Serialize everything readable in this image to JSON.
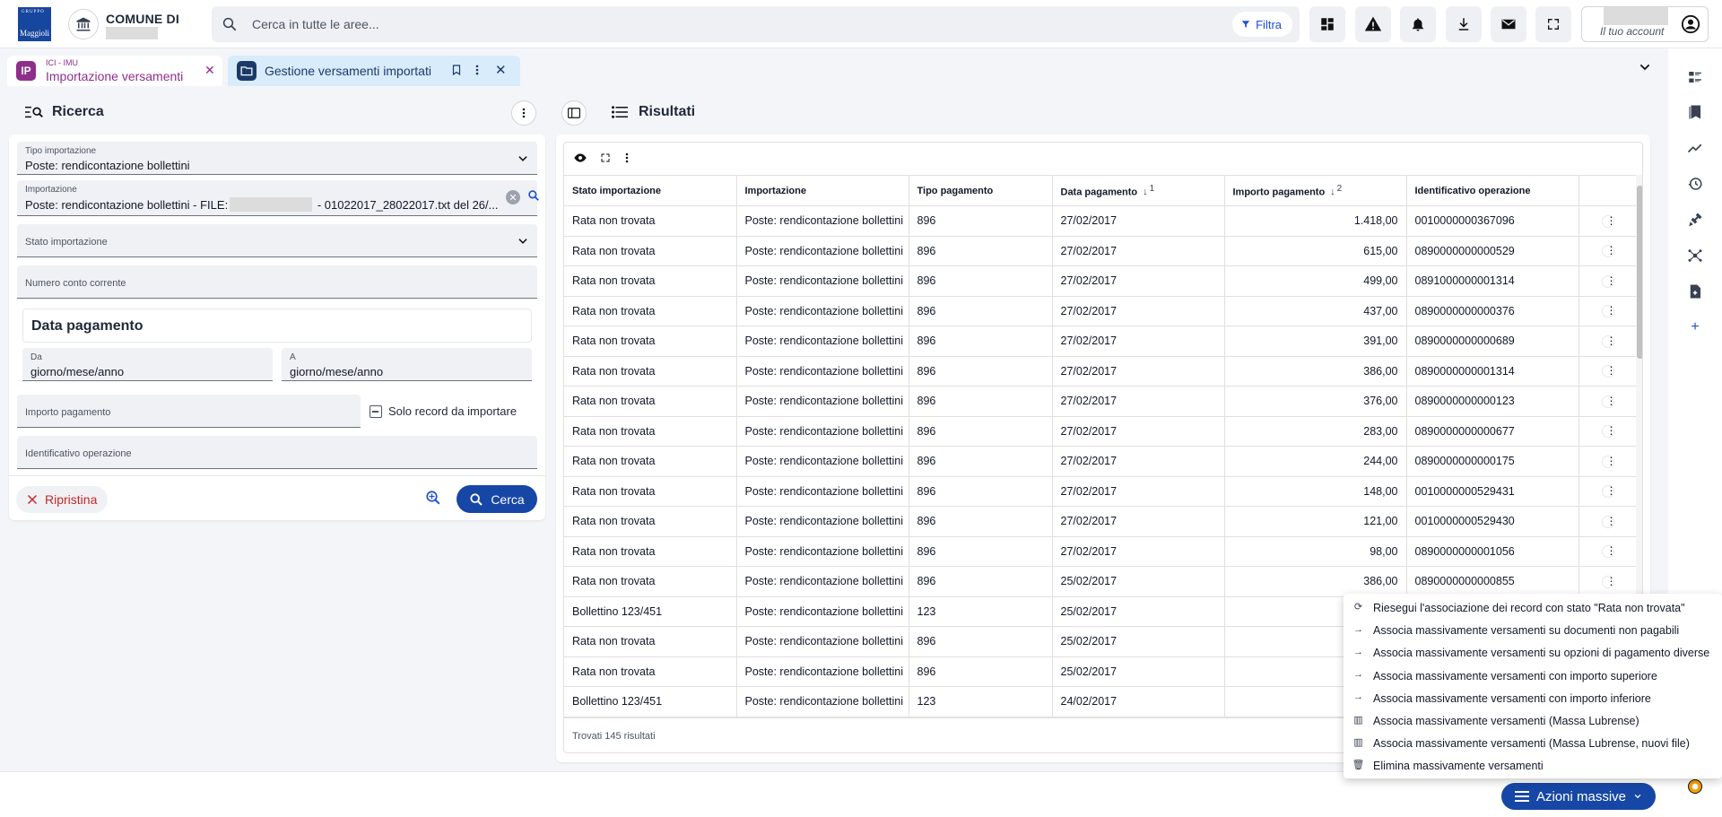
{
  "header": {
    "logo_top": "GRUPPO",
    "logo_text": "Maggioli",
    "comune_title": "COMUNE DI",
    "search_placeholder": "Cerca in tutte le aree...",
    "filter_label": "Filtra",
    "account_label": "Il tuo account"
  },
  "tabs": [
    {
      "module": "ICI - IMU",
      "label": "Importazione versamenti",
      "icon_text": "IP"
    },
    {
      "label": "Gestione versamenti importati"
    }
  ],
  "search_panel": {
    "title": "Ricerca",
    "fields": {
      "tipo_importazione": {
        "label": "Tipo importazione",
        "value": "Poste: rendicontazione bollettini"
      },
      "importazione": {
        "label": "Importazione",
        "value_prefix": "Poste: rendicontazione bollettini - FILE:",
        "value_suffix": "- 01022017_28022017.txt del 26/..."
      },
      "stato_importazione": {
        "label": "Stato importazione"
      },
      "numero_conto": {
        "label": "Numero conto corrente"
      },
      "data_pagamento_title": "Data pagamento",
      "da": {
        "label": "Da",
        "value": "giorno/mese/anno"
      },
      "a": {
        "label": "A",
        "value": "giorno/mese/anno"
      },
      "importo": {
        "label": "Importo pagamento"
      },
      "solo_record": "Solo record da importare",
      "identificativo": {
        "label": "Identificativo operazione"
      }
    },
    "reset_label": "Ripristina",
    "search_label": "Cerca"
  },
  "results": {
    "title": "Risultati",
    "columns": [
      "Stato importazione",
      "Importazione",
      "Tipo pagamento",
      "Data pagamento",
      "Importo pagamento",
      "Identificativo operazione"
    ],
    "sort": {
      "data_pagamento": "1",
      "importo_pagamento": "2"
    },
    "rows": [
      [
        "Rata non trovata",
        "Poste: rendicontazione bollettini",
        "896",
        "27/02/2017",
        "1.418,00",
        "0010000000367096"
      ],
      [
        "Rata non trovata",
        "Poste: rendicontazione bollettini",
        "896",
        "27/02/2017",
        "615,00",
        "0890000000000529"
      ],
      [
        "Rata non trovata",
        "Poste: rendicontazione bollettini",
        "896",
        "27/02/2017",
        "499,00",
        "0891000000001314"
      ],
      [
        "Rata non trovata",
        "Poste: rendicontazione bollettini",
        "896",
        "27/02/2017",
        "437,00",
        "0890000000000376"
      ],
      [
        "Rata non trovata",
        "Poste: rendicontazione bollettini",
        "896",
        "27/02/2017",
        "391,00",
        "0890000000000689"
      ],
      [
        "Rata non trovata",
        "Poste: rendicontazione bollettini",
        "896",
        "27/02/2017",
        "386,00",
        "0890000000001314"
      ],
      [
        "Rata non trovata",
        "Poste: rendicontazione bollettini",
        "896",
        "27/02/2017",
        "376,00",
        "0890000000000123"
      ],
      [
        "Rata non trovata",
        "Poste: rendicontazione bollettini",
        "896",
        "27/02/2017",
        "283,00",
        "0890000000000677"
      ],
      [
        "Rata non trovata",
        "Poste: rendicontazione bollettini",
        "896",
        "27/02/2017",
        "244,00",
        "0890000000000175"
      ],
      [
        "Rata non trovata",
        "Poste: rendicontazione bollettini",
        "896",
        "27/02/2017",
        "148,00",
        "0010000000529431"
      ],
      [
        "Rata non trovata",
        "Poste: rendicontazione bollettini",
        "896",
        "27/02/2017",
        "121,00",
        "0010000000529430"
      ],
      [
        "Rata non trovata",
        "Poste: rendicontazione bollettini",
        "896",
        "27/02/2017",
        "98,00",
        "0890000000001056"
      ],
      [
        "Rata non trovata",
        "Poste: rendicontazione bollettini",
        "896",
        "25/02/2017",
        "386,00",
        "0890000000000855"
      ],
      [
        "Bollettino 123/451",
        "Poste: rendicontazione bollettini",
        "123",
        "25/02/2017",
        "",
        ""
      ],
      [
        "Rata non trovata",
        "Poste: rendicontazione bollettini",
        "896",
        "25/02/2017",
        "",
        ""
      ],
      [
        "Rata non trovata",
        "Poste: rendicontazione bollettini",
        "896",
        "25/02/2017",
        "",
        ""
      ],
      [
        "Bollettino 123/451",
        "Poste: rendicontazione bollettini",
        "123",
        "24/02/2017",
        "",
        ""
      ]
    ],
    "found_text": "Trovati 145 risultati"
  },
  "actions_menu": {
    "button_label": "Azioni massive",
    "items": [
      {
        "icon": "refresh-icon",
        "label": "Riesegui l'associazione dei record con stato \"Rata non trovata\""
      },
      {
        "icon": "arrow-right-icon",
        "label": "Associa massivamente versamenti su documenti non pagabili"
      },
      {
        "icon": "arrow-right-icon",
        "label": "Associa massivamente versamenti su opzioni di pagamento diverse"
      },
      {
        "icon": "arrow-right-icon",
        "label": "Associa massivamente versamenti con importo superiore"
      },
      {
        "icon": "arrow-right-icon",
        "label": "Associa massivamente versamenti con importo inferiore"
      },
      {
        "icon": "barcode-icon",
        "label": "Associa massivamente versamenti (Massa Lubrense)"
      },
      {
        "icon": "barcode-icon",
        "label": "Associa massivamente versamenti (Massa Lubrense, nuovi file)"
      },
      {
        "icon": "trash-icon",
        "label": "Elimina massivamente versamenti"
      }
    ]
  },
  "colors": {
    "primary": "#1747a6",
    "tab_active_bg": "#d8ecfb",
    "module_purple": "#8e2f8c",
    "danger": "#c62828"
  }
}
